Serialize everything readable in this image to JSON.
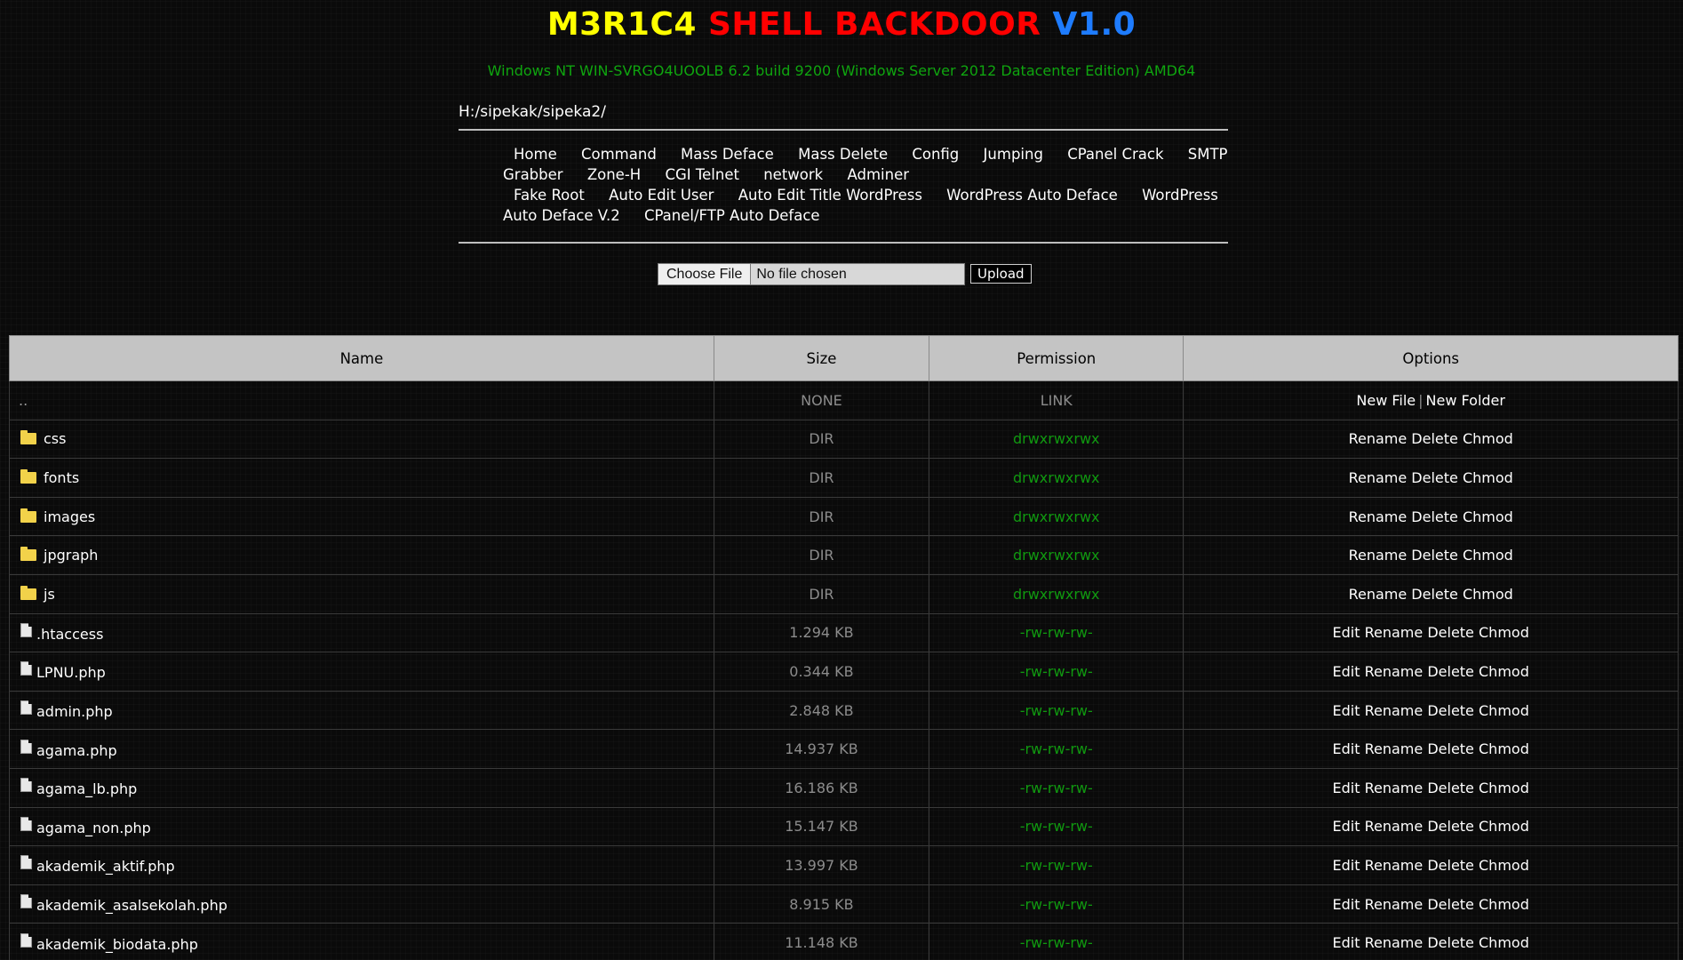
{
  "header": {
    "title_part1": "M3R1C4",
    "title_part2": "SHELL BACKDOOR",
    "title_part3": "V1.0",
    "sysinfo": "Windows NT WIN-SVRGO4UOOLB 6.2 build 9200 (Windows Server 2012 Datacenter Edition) AMD64",
    "path": "H:/sipekak/sipeka2/"
  },
  "menu": {
    "items": [
      "Home",
      "Command",
      "Mass Deface",
      "Mass Delete",
      "Config",
      "Jumping",
      "CPanel Crack",
      "SMTP Grabber",
      "Zone-H",
      "CGI Telnet",
      "network",
      "Adminer",
      "Fake Root",
      "Auto Edit User",
      "Auto Edit Title WordPress",
      "WordPress Auto Deface",
      "WordPress Auto Deface V.2",
      "CPanel/FTP Auto Deface"
    ]
  },
  "upload": {
    "choose_label": "Choose File",
    "chosen_text": "No file chosen",
    "button_label": "Upload"
  },
  "table": {
    "headers": [
      "Name",
      "Size",
      "Permission",
      "Options"
    ],
    "parent": {
      "name": "..",
      "size": "NONE",
      "perm": "LINK",
      "new_file": "New File",
      "separator": "|",
      "new_folder": "New Folder"
    },
    "option_labels": {
      "edit": "Edit",
      "rename": "Rename",
      "delete": "Delete",
      "chmod": "Chmod"
    },
    "rows": [
      {
        "type": "dir",
        "name": "css",
        "size": "DIR",
        "perm": "drwxrwxrwx"
      },
      {
        "type": "dir",
        "name": "fonts",
        "size": "DIR",
        "perm": "drwxrwxrwx"
      },
      {
        "type": "dir",
        "name": "images",
        "size": "DIR",
        "perm": "drwxrwxrwx"
      },
      {
        "type": "dir",
        "name": "jpgraph",
        "size": "DIR",
        "perm": "drwxrwxrwx"
      },
      {
        "type": "dir",
        "name": "js",
        "size": "DIR",
        "perm": "drwxrwxrwx"
      },
      {
        "type": "file",
        "name": ".htaccess",
        "size": "1.294 KB",
        "perm": "-rw-rw-rw-"
      },
      {
        "type": "file",
        "name": "LPNU.php",
        "size": "0.344 KB",
        "perm": "-rw-rw-rw-"
      },
      {
        "type": "file",
        "name": "admin.php",
        "size": "2.848 KB",
        "perm": "-rw-rw-rw-"
      },
      {
        "type": "file",
        "name": "agama.php",
        "size": "14.937 KB",
        "perm": "-rw-rw-rw-"
      },
      {
        "type": "file",
        "name": "agama_lb.php",
        "size": "16.186 KB",
        "perm": "-rw-rw-rw-"
      },
      {
        "type": "file",
        "name": "agama_non.php",
        "size": "15.147 KB",
        "perm": "-rw-rw-rw-"
      },
      {
        "type": "file",
        "name": "akademik_aktif.php",
        "size": "13.997 KB",
        "perm": "-rw-rw-rw-"
      },
      {
        "type": "file",
        "name": "akademik_asalsekolah.php",
        "size": "8.915 KB",
        "perm": "-rw-rw-rw-"
      },
      {
        "type": "file",
        "name": "akademik_biodata.php",
        "size": "11.148 KB",
        "perm": "-rw-rw-rw-"
      }
    ]
  }
}
